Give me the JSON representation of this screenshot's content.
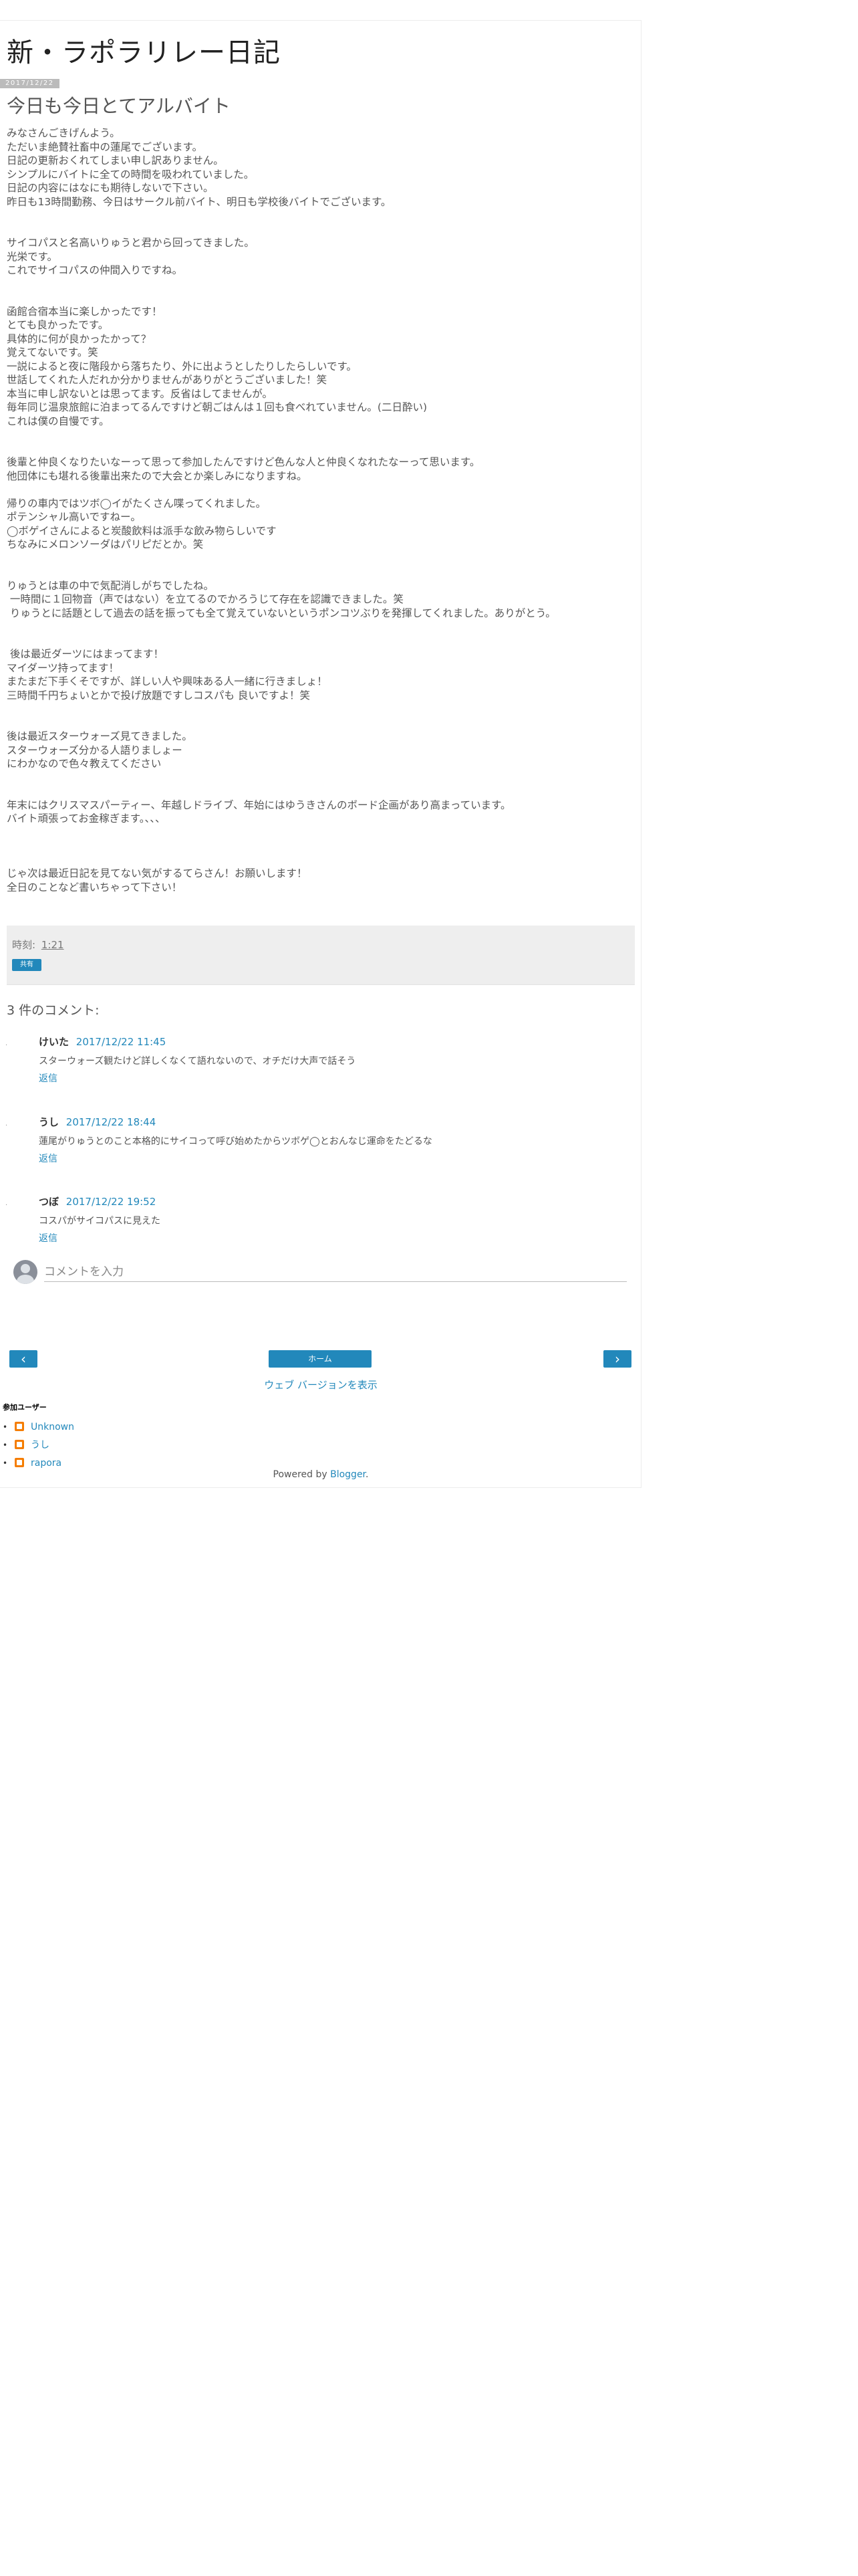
{
  "blog": {
    "title": "新・ラポラリレー日記"
  },
  "post": {
    "date_header": "2017/12/22",
    "title": "今日も今日とてアルバイト",
    "body_lines": [
      "みなさんごきげんよう。",
      "ただいま絶賛社畜中の蓮尾でございます。",
      "日記の更新おくれてしまい申し訳ありません。",
      "シンプルにバイトに全ての時間を吸われていました。",
      "日記の内容にはなにも期待しないで下さい。",
      "昨日も13時間勤務、今日はサークル前バイト、明日も学校後バイトでございます。",
      "",
      "",
      "サイコパスと名高いりゅうと君から回ってきました。",
      "光栄です。",
      "これでサイコパスの仲間入りですね。",
      "",
      "",
      "函館合宿本当に楽しかったです！",
      "とても良かったです。",
      "具体的に何が良かったかって？",
      "覚えてないです。笑",
      "一説によると夜に階段から落ちたり、外に出ようとしたりしたらしいです。",
      "世話してくれた人だれか分かりませんがありがとうございました！笑",
      "本当に申し訳ないとは思ってます。反省はしてませんが。",
      "毎年同じ温泉旅館に泊まってるんですけど朝ごはんは１回も食べれていません。(二日酔い)",
      "これは僕の自慢です。",
      "",
      "",
      "後輩と仲良くなりたいなーって思って参加したんですけど色んな人と仲良くなれたなーって思います。",
      "他団体にも堪れる後輩出来たので大会とか楽しみになりますね。",
      "",
      "帰りの車内ではツボ◯イがたくさん喋ってくれました。",
      "ポテンシャル高いですねー。",
      "◯ボゲイさんによると炭酸飲料は派手な飲み物らしいです",
      "ちなみにメロンソーダはパリピだとか。笑",
      "",
      "",
      "りゅうとは車の中で気配消しがちでしたね。",
      " 一時間に１回物音（声ではない）を立てるのでかろうじて存在を認識できました。笑",
      " りゅうとに話題として過去の話を振っても全て覚えていないというポンコツぶりを発揮してくれました。ありがとう。",
      "",
      "",
      " 後は最近ダーツにはまってます！",
      "マイダーツ持ってます！",
      "またまだ下手くそですが、詳しい人や興味ある人一緒に行きましょ！",
      "三時間千円ちょいとかで投げ放題ですしコスパも 良いですよ！笑",
      "",
      "",
      "後は最近スターウォーズ見てきました。",
      "スターウォーズ分かる人語りましょー",
      "にわかなので色々教えてください",
      "",
      "",
      "年末にはクリスマスパーティー、年越しドライブ、年始にはゆうきさんのボード企画があり高まっています。",
      "バイト頑張ってお金稼ぎます。、、、",
      "",
      "",
      "",
      "じゃ次は最近日記を見てない気がするてらさん！お願いします！",
      "全日のことなど書いちゃって下さい！"
    ]
  },
  "post_footer": {
    "time_label": "時刻:",
    "time_value": "1:21",
    "share_label": "共有"
  },
  "comments": {
    "heading": "3 件のコメント:",
    "items": [
      {
        "author": "けいた",
        "timestamp": "2017/12/22 11:45",
        "text": "スターウォーズ観たけど詳しくなくて語れないので、オチだけ大声で話そう",
        "reply_label": "返信"
      },
      {
        "author": "うし",
        "timestamp": "2017/12/22 18:44",
        "text": "蓮尾がりゅうとのこと本格的にサイコって呼び始めたからツボゲ◯とおんなじ運命をたどるな",
        "reply_label": "返信"
      },
      {
        "author": "つぼ",
        "timestamp": "2017/12/22 19:52",
        "text": "コスパがサイコパスに見えた",
        "reply_label": "返信"
      }
    ],
    "input_placeholder": "コメントを入力"
  },
  "nav": {
    "older_glyph": "‹",
    "home_label": "ホーム",
    "newer_glyph": "›",
    "web_version_label": "ウェブ バージョンを表示"
  },
  "contributors": {
    "heading": "参加ユーザー",
    "items": [
      "Unknown",
      "うし",
      "rapora"
    ]
  },
  "footer": {
    "powered_prefix": "Powered by ",
    "powered_link": "Blogger",
    "powered_suffix": "."
  },
  "colors": {
    "accent": "#2288bb",
    "date_header_bg": "#bbbbbb",
    "footer_bg": "#eeeeee",
    "profile_icon": "#f57d00"
  },
  "icons": {
    "profile": "blogger-profile-icon",
    "avatar": "default-avatar-icon"
  }
}
